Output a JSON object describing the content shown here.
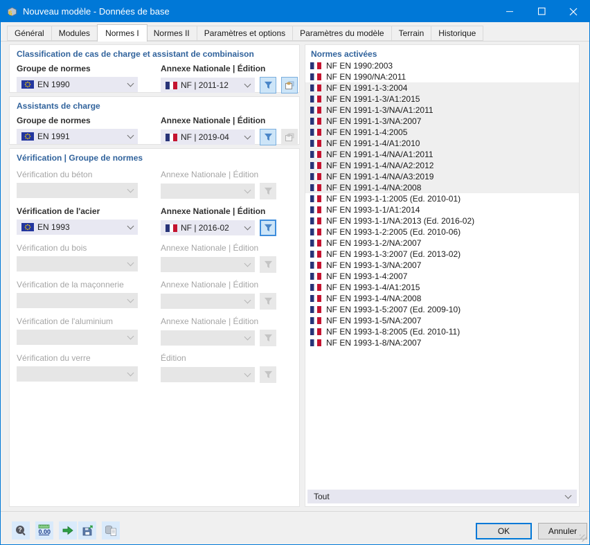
{
  "window": {
    "title": "Nouveau modèle - Données de base"
  },
  "tabs": {
    "items": [
      "Général",
      "Modules",
      "Normes I",
      "Normes II",
      "Paramètres et options",
      "Paramètres du modèle",
      "Terrain",
      "Historique"
    ],
    "active": "Normes I"
  },
  "classification": {
    "title": "Classification de cas de charge et assistant de combinaison",
    "group_label": "Groupe de normes",
    "group_value": "EN 1990",
    "annex_label": "Annexe Nationale | Édition",
    "annex_value": "NF | 2011-12"
  },
  "assistants": {
    "title": "Assistants de charge",
    "group_label": "Groupe de normes",
    "group_value": "EN 1991",
    "annex_label": "Annexe Nationale | Édition",
    "annex_value": "NF | 2019-04"
  },
  "verification": {
    "title": "Vérification | Groupe de normes",
    "rows": [
      {
        "label": "Vérification du béton",
        "annex_label": "Annexe Nationale | Édition",
        "enabled": false,
        "group_value": "",
        "annex_value": ""
      },
      {
        "label": "Vérification de l'acier",
        "annex_label": "Annexe Nationale | Édition",
        "enabled": true,
        "group_value": "EN 1993",
        "annex_value": "NF | 2016-02"
      },
      {
        "label": "Vérification du bois",
        "annex_label": "Annexe Nationale | Édition",
        "enabled": false,
        "group_value": "",
        "annex_value": ""
      },
      {
        "label": "Vérification de la maçonnerie",
        "annex_label": "Annexe Nationale | Édition",
        "enabled": false,
        "group_value": "",
        "annex_value": ""
      },
      {
        "label": "Vérification de l'aluminium",
        "annex_label": "Annexe Nationale | Édition",
        "enabled": false,
        "group_value": "",
        "annex_value": ""
      },
      {
        "label": "Vérification du verre",
        "annex_label": "Édition",
        "enabled": false,
        "group_value": "",
        "annex_value": ""
      }
    ]
  },
  "norms": {
    "title": "Normes activées",
    "filter_value": "Tout",
    "items": [
      {
        "label": "NF EN 1990:2003",
        "band": false
      },
      {
        "label": "NF EN 1990/NA:2011",
        "band": false
      },
      {
        "label": "NF EN 1991-1-3:2004",
        "band": true
      },
      {
        "label": "NF EN 1991-1-3/A1:2015",
        "band": true
      },
      {
        "label": "NF EN 1991-1-3/NA/A1:2011",
        "band": true
      },
      {
        "label": "NF EN 1991-1-3/NA:2007",
        "band": true
      },
      {
        "label": "NF EN 1991-1-4:2005",
        "band": true
      },
      {
        "label": "NF EN 1991-1-4/A1:2010",
        "band": true
      },
      {
        "label": "NF EN 1991-1-4/NA/A1:2011",
        "band": true
      },
      {
        "label": "NF EN 1991-1-4/NA/A2:2012",
        "band": true
      },
      {
        "label": "NF EN 1991-1-4/NA/A3:2019",
        "band": true
      },
      {
        "label": "NF EN 1991-1-4/NA:2008",
        "band": true
      },
      {
        "label": "NF EN 1993-1-1:2005 (Ed. 2010-01)",
        "band": false
      },
      {
        "label": "NF EN 1993-1-1/A1:2014",
        "band": false
      },
      {
        "label": "NF EN 1993-1-1/NA:2013 (Ed. 2016-02)",
        "band": false
      },
      {
        "label": "NF EN 1993-1-2:2005 (Ed. 2010-06)",
        "band": false
      },
      {
        "label": "NF EN 1993-1-2/NA:2007",
        "band": false
      },
      {
        "label": "NF EN 1993-1-3:2007 (Ed. 2013-02)",
        "band": false
      },
      {
        "label": "NF EN 1993-1-3/NA:2007",
        "band": false
      },
      {
        "label": "NF EN 1993-1-4:2007",
        "band": false
      },
      {
        "label": "NF EN 1993-1-4/A1:2015",
        "band": false
      },
      {
        "label": "NF EN 1993-1-4/NA:2008",
        "band": false
      },
      {
        "label": "NF EN 1993-1-5:2007 (Ed. 2009-10)",
        "band": false
      },
      {
        "label": "NF EN 1993-1-5/NA:2007",
        "band": false
      },
      {
        "label": "NF EN 1993-1-8:2005 (Ed. 2010-11)",
        "band": false
      },
      {
        "label": "NF EN 1993-1-8/NA:2007",
        "band": false
      }
    ]
  },
  "footer": {
    "ok": "OK",
    "cancel": "Annuler",
    "tool_icons": [
      "help-icon",
      "units-decimals-icon",
      "comment-icon",
      "save-template-icon",
      "copy-model-icon"
    ]
  },
  "colors": {
    "titlebar": "#0078d7",
    "accent": "#0078d7",
    "section_header": "#31639c",
    "dropdown_bg": "#e8e8f2",
    "band": "#efefef",
    "filter_button_bg": "#cde5f8"
  }
}
